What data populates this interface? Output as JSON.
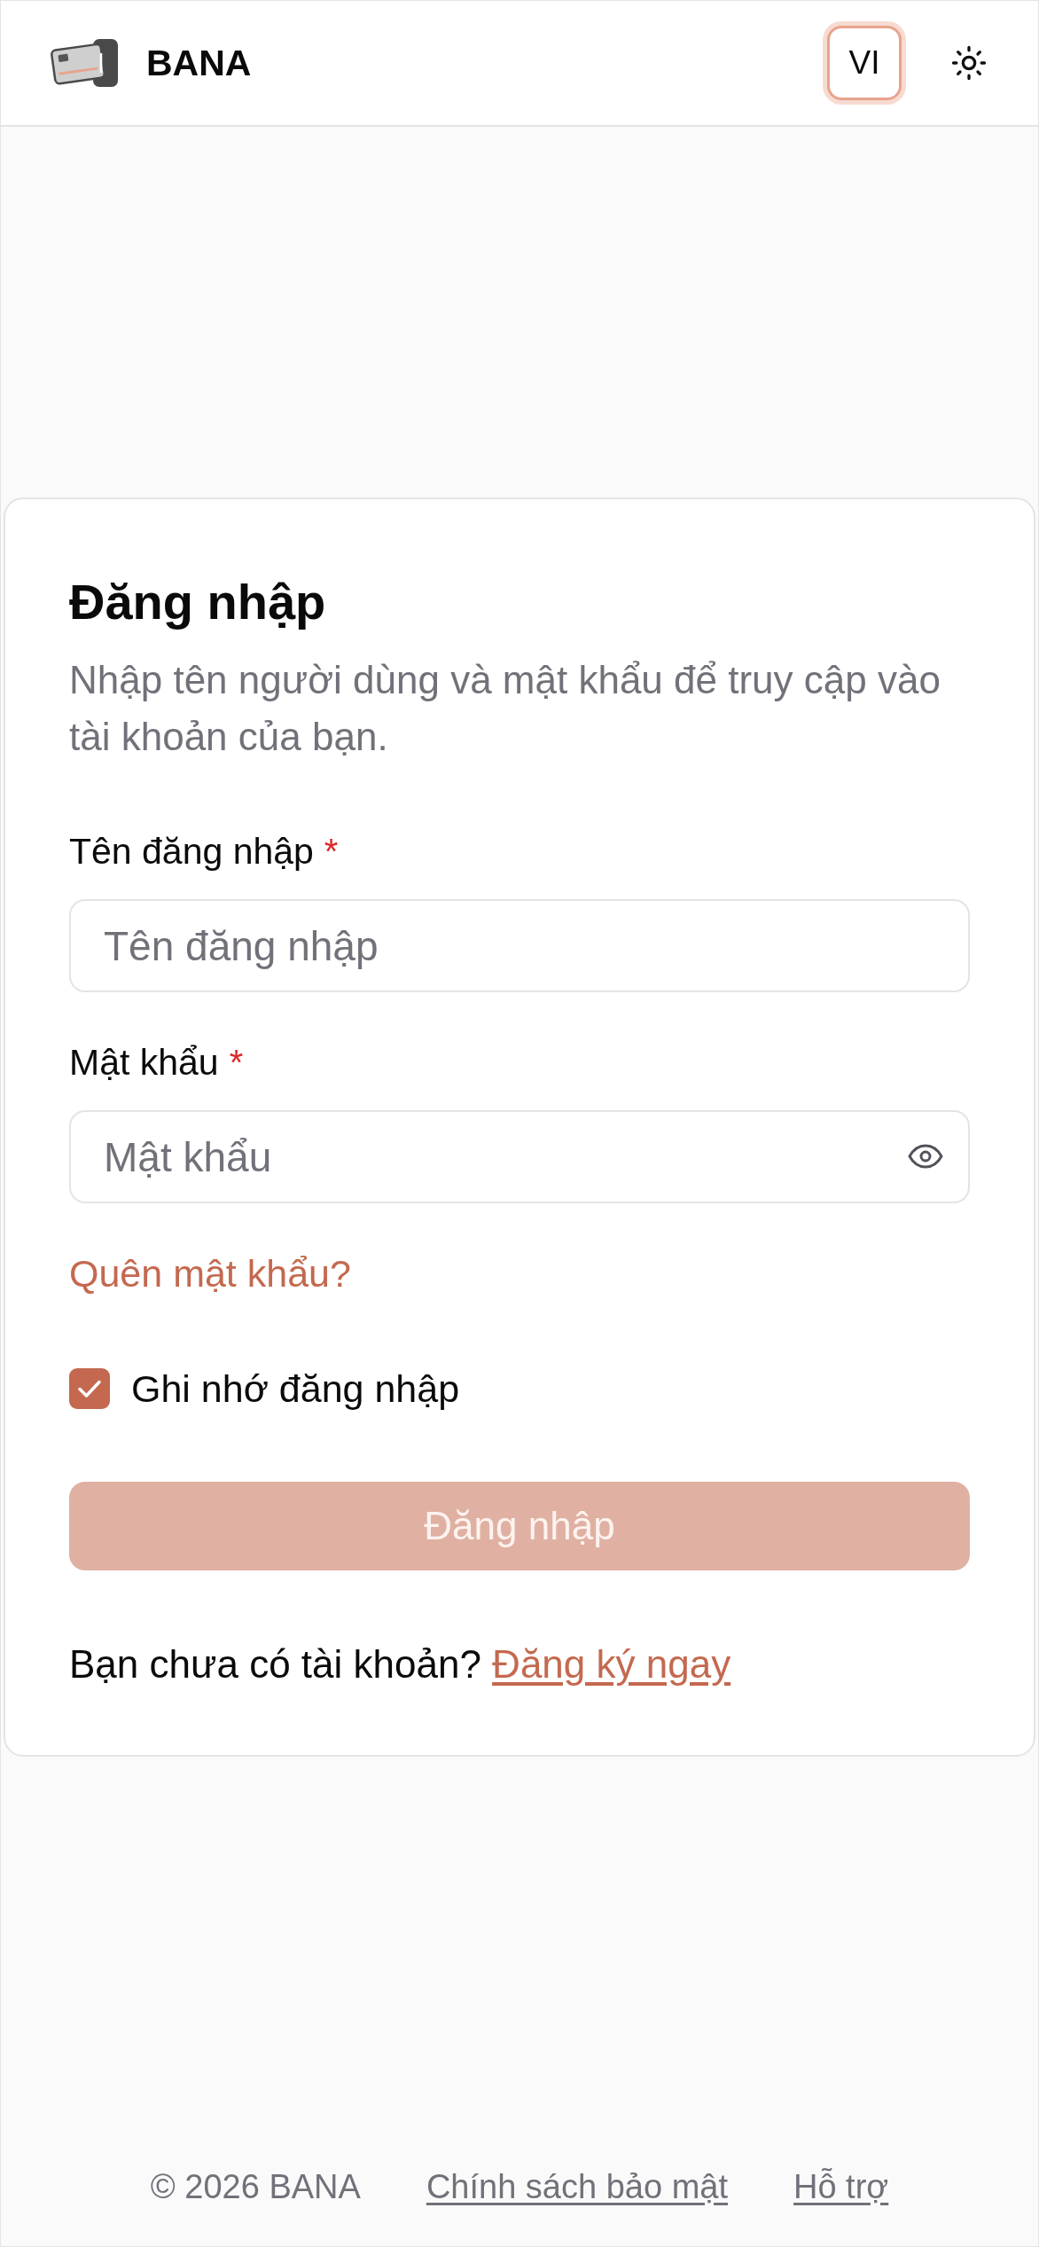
{
  "header": {
    "logo_text": "BANA",
    "language_button": "VI"
  },
  "login_card": {
    "title": "Đăng nhập",
    "description": "Nhập tên người dùng và mật khẩu để truy cập vào tài khoản của bạn.",
    "fields": [
      {
        "kind": "text",
        "label": "Tên đăng nhập",
        "required_mark": "*",
        "placeholder": "Tên đăng nhập"
      },
      {
        "kind": "password",
        "label": "Mật khẩu",
        "required_mark": "*",
        "placeholder": "Mật khẩu"
      }
    ],
    "forgot_link": "Quên mật khẩu?",
    "remember": {
      "label": "Ghi nhớ đăng nhập",
      "checked": true
    },
    "submit_button": {
      "label": "Đăng nhập",
      "disabled": true
    },
    "signup_prompt": {
      "text": "Bạn chưa có tài khoản?",
      "link": "Đăng ký ngay"
    }
  },
  "footer": {
    "copyright": "© 2026 BANA",
    "links": [
      "Chính sách bảo mật",
      "Hỗ trợ"
    ]
  }
}
